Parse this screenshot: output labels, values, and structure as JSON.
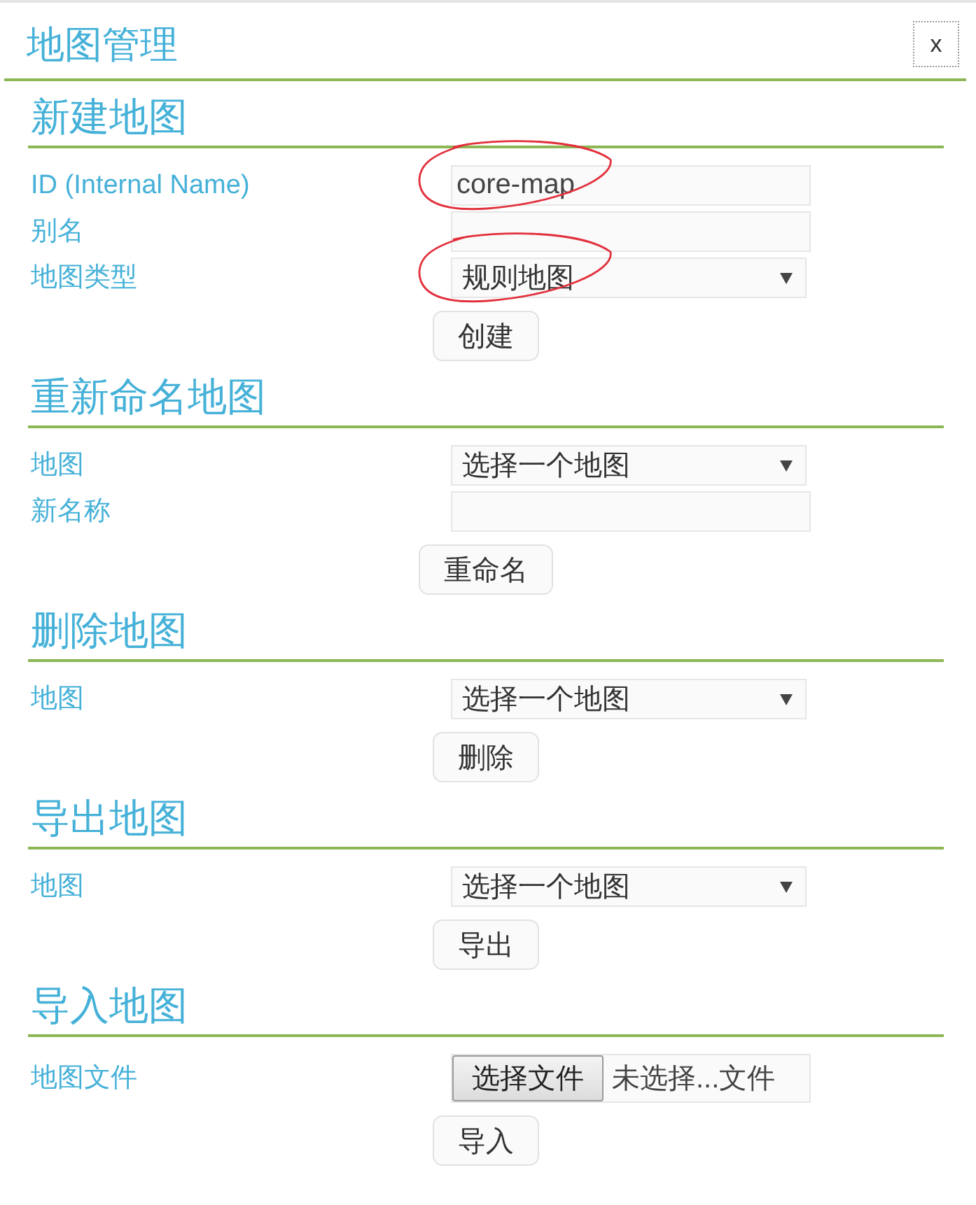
{
  "dialog": {
    "title": "地图管理",
    "close_button": "x"
  },
  "sections": [
    {
      "heading": "新建地图",
      "rows": [
        {
          "kind": "text",
          "label": "ID (Internal Name)",
          "value": "core-map",
          "annotated": true
        },
        {
          "kind": "text",
          "label": "别名",
          "annotated": false
        },
        {
          "kind": "select",
          "label": "地图类型",
          "value": "规则地图",
          "annotated": true
        }
      ],
      "button": "创建"
    },
    {
      "heading": "重新命名地图",
      "rows": [
        {
          "kind": "select",
          "label": "地图",
          "value": "选择一个地图",
          "annotated": false
        },
        {
          "kind": "text",
          "label": "新名称",
          "annotated": false
        }
      ],
      "button": "重命名"
    },
    {
      "heading": "删除地图",
      "rows": [
        {
          "kind": "select",
          "label": "地图",
          "value": "选择一个地图",
          "annotated": false
        }
      ],
      "button": "删除"
    },
    {
      "heading": "导出地图",
      "rows": [
        {
          "kind": "select",
          "label": "地图",
          "value": "选择一个地图",
          "annotated": false
        }
      ],
      "button": "导出"
    },
    {
      "heading": "导入地图",
      "rows": [
        {
          "kind": "file",
          "label": "地图文件",
          "button": "选择文件",
          "status": "未选择...文件",
          "annotated": false
        }
      ],
      "button": "导入"
    }
  ]
}
